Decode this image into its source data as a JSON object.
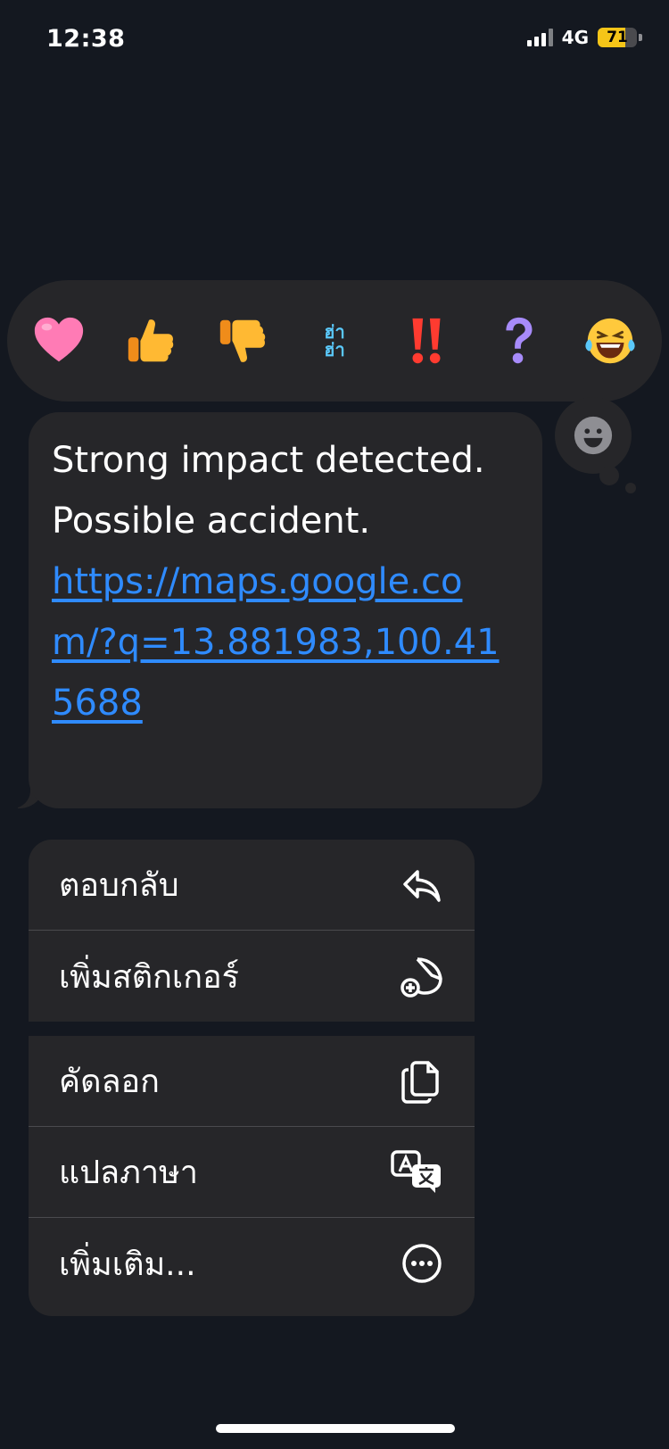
{
  "status_bar": {
    "time": "12:38",
    "network": "4G",
    "battery": "71"
  },
  "tapbacks": [
    {
      "name": "heart-icon"
    },
    {
      "name": "thumbs-up-icon"
    },
    {
      "name": "thumbs-down-icon"
    },
    {
      "name": "haha-icon",
      "line1": "ฮ่า",
      "line2": "ฮ่า"
    },
    {
      "name": "double-exclamation-icon"
    },
    {
      "name": "question-icon"
    },
    {
      "name": "laughing-emoji-icon"
    }
  ],
  "message": {
    "line1": "Strong impact detected.",
    "line2": "Possible accident.",
    "link": "https://maps.google.com/?q=13.881983,100.415688"
  },
  "menu": {
    "reply": "ตอบกลับ",
    "add_sticker": "เพิ่มสติกเกอร์",
    "copy": "คัดลอก",
    "translate": "แปลภาษา",
    "more": "เพิ่มเติม..."
  }
}
